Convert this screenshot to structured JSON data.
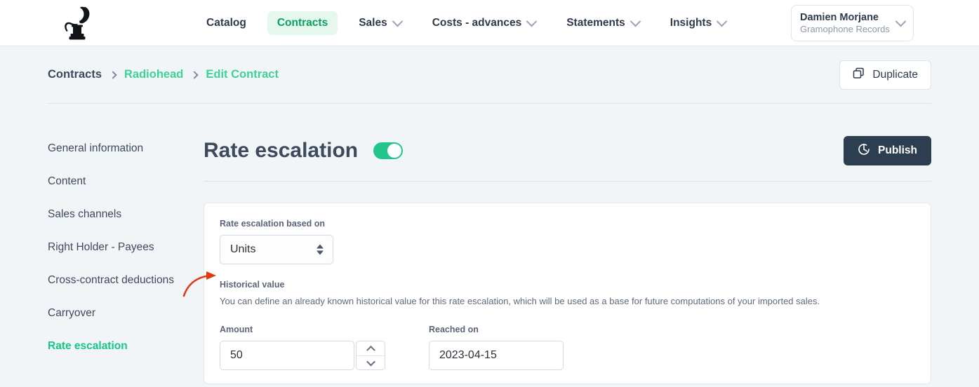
{
  "nav": {
    "logo_icon": "gramophone-logo",
    "items": [
      {
        "label": "Catalog",
        "caret": false,
        "active": false
      },
      {
        "label": "Contracts",
        "caret": false,
        "active": true
      },
      {
        "label": "Sales",
        "caret": true,
        "active": false
      },
      {
        "label": "Costs - advances",
        "caret": true,
        "active": false
      },
      {
        "label": "Statements",
        "caret": true,
        "active": false
      },
      {
        "label": "Insights",
        "caret": true,
        "active": false
      }
    ],
    "user": {
      "name": "Damien Morjane",
      "org": "Gramophone Records",
      "caret_icon": "chevron-down-icon"
    }
  },
  "breadcrumb": {
    "items": [
      {
        "label": "Contracts",
        "link": false
      },
      {
        "label": "Radiohead",
        "link": true
      },
      {
        "label": "Edit Contract",
        "link": true
      }
    ],
    "separator_icon": "chevron-right-icon"
  },
  "actions": {
    "duplicate_label": "Duplicate",
    "duplicate_icon": "copy-icon",
    "publish_label": "Publish",
    "publish_icon": "check-circle-icon"
  },
  "sidebar": {
    "items": [
      {
        "label": "General information",
        "active": false
      },
      {
        "label": "Content",
        "active": false
      },
      {
        "label": "Sales channels",
        "active": false
      },
      {
        "label": "Right Holder - Payees",
        "active": false
      },
      {
        "label": "Cross-contract deductions",
        "active": false
      },
      {
        "label": "Carryover",
        "active": false
      },
      {
        "label": "Rate escalation",
        "active": true
      }
    ]
  },
  "main": {
    "title": "Rate escalation",
    "toggle_on": true,
    "form": {
      "based_on_label": "Rate escalation based on",
      "based_on_value": "Units",
      "based_on_icon": "updown-selector-icon",
      "historical_title": "Historical value",
      "historical_desc": "You can define an already known historical value for this rate escalation, which will be used as a base for future computations of your imported sales.",
      "amount_label": "Amount",
      "amount_value": "50",
      "spinner_up_icon": "chevron-up-icon",
      "spinner_down_icon": "chevron-down-icon",
      "reached_label": "Reached on",
      "reached_value": "2023-04-15"
    }
  },
  "annotation": {
    "arrow_icon": "red-arrow-icon",
    "arrow_color": "#e03a12"
  },
  "colors": {
    "page_bg": "#f2f5f8",
    "accent_green": "#16c784",
    "nav_active_bg": "#e6f8ee",
    "publish_bg": "#2c3e50"
  }
}
